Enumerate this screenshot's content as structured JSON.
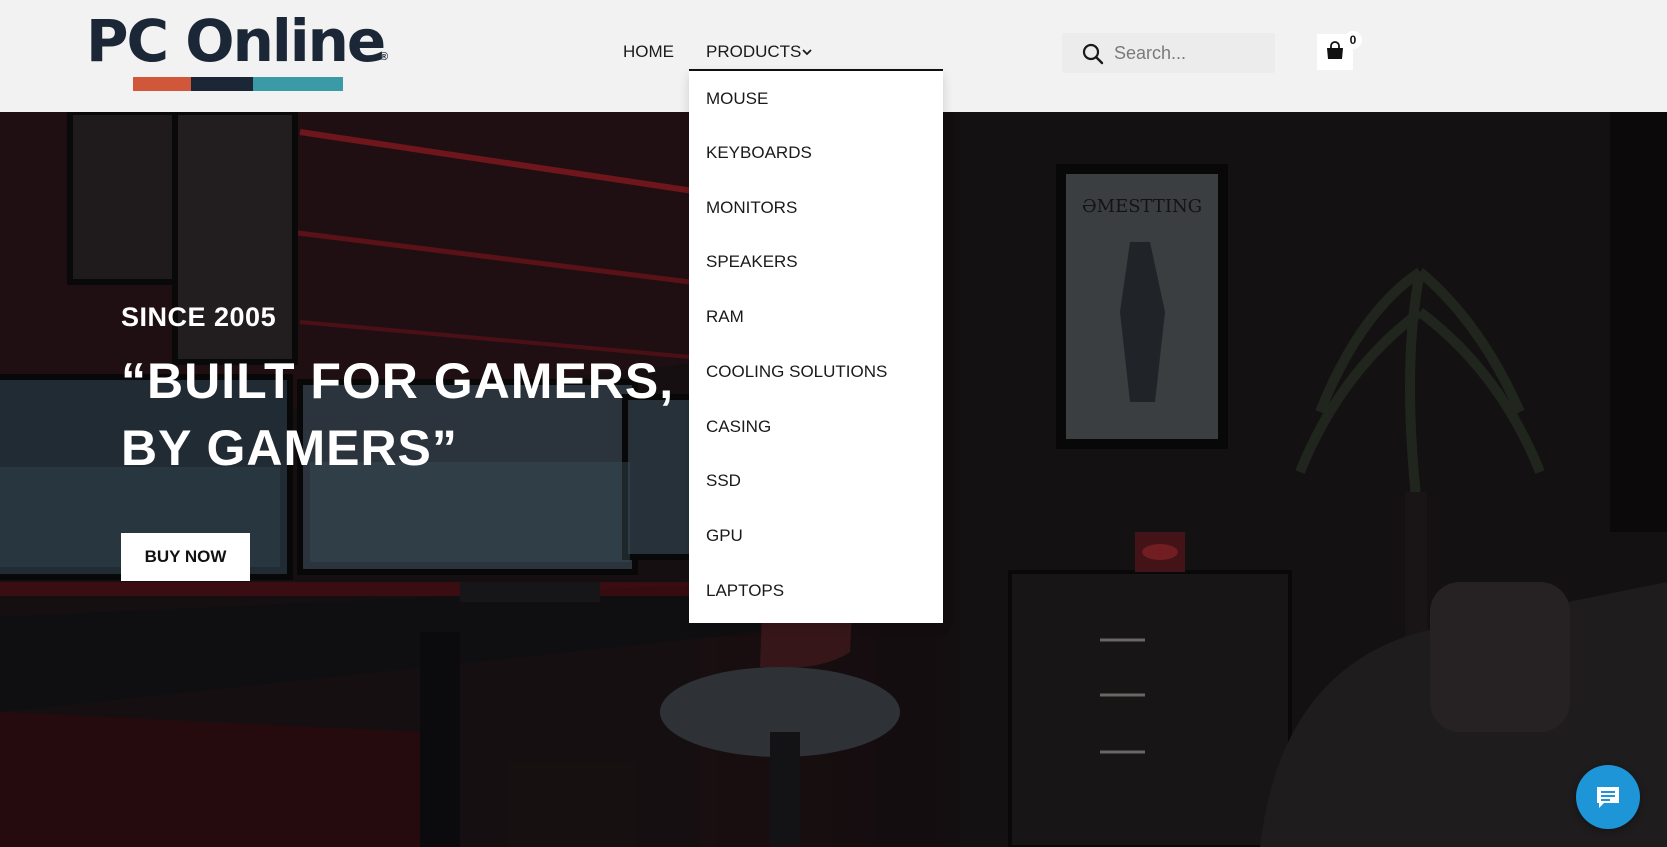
{
  "brand": {
    "name": "PC Online",
    "registered_mark": "®",
    "bar_colors": [
      "#d0573a",
      "#1b2636",
      "#3a9aa5"
    ]
  },
  "nav": {
    "home_label": "HOME",
    "products_label": "PRODUCTS"
  },
  "search": {
    "placeholder": "Search...",
    "icon": "search-icon"
  },
  "cart": {
    "count": "0",
    "icon": "shopping-bag-icon"
  },
  "dropdown": {
    "items": [
      {
        "label": "MOUSE"
      },
      {
        "label": "KEYBOARDS"
      },
      {
        "label": "MONITORS"
      },
      {
        "label": "SPEAKERS"
      },
      {
        "label": "RAM"
      },
      {
        "label": "COOLING SOLUTIONS"
      },
      {
        "label": "CASING"
      },
      {
        "label": "SSD"
      },
      {
        "label": "GPU"
      },
      {
        "label": "LAPTOPS"
      }
    ]
  },
  "hero": {
    "since": "SINCE 2005",
    "title": "“BUILT FOR GAMERS, BY GAMERS”",
    "cta_label": "BUY NOW"
  },
  "colors": {
    "header_bg": "#f2f2f2",
    "brand_navy": "#1b2636",
    "chat_blue": "#1d95d6"
  },
  "chat": {
    "icon": "chat-bubble-icon"
  }
}
